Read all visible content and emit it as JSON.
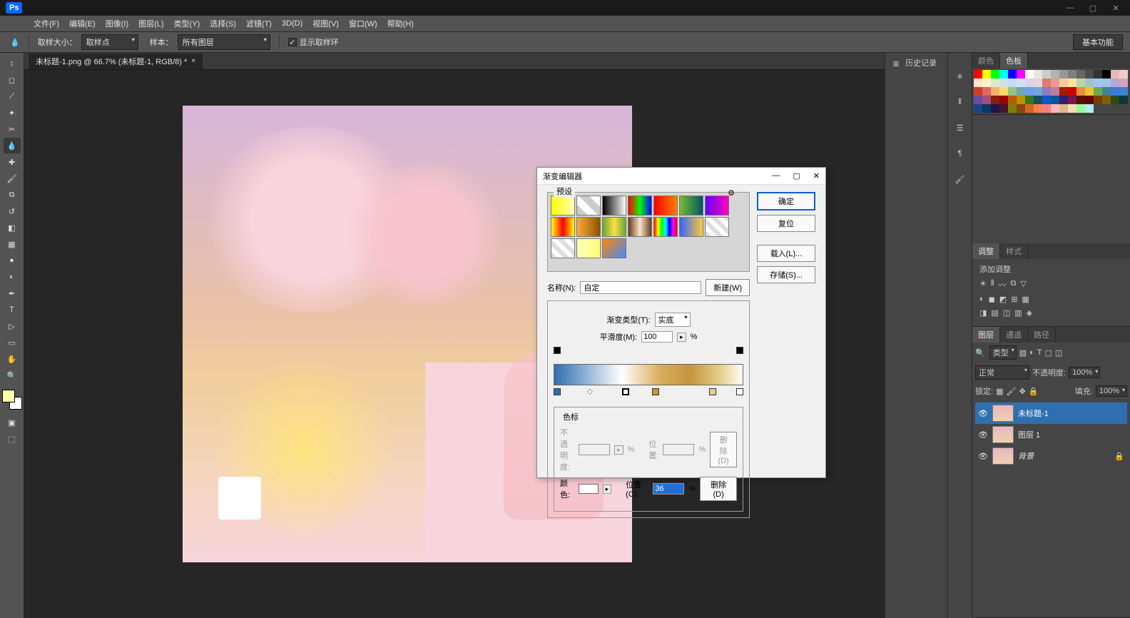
{
  "app": {
    "logo": "Ps"
  },
  "menu": [
    "文件(F)",
    "编辑(E)",
    "图像(I)",
    "图层(L)",
    "类型(Y)",
    "选择(S)",
    "滤镜(T)",
    "3D(D)",
    "视图(V)",
    "窗口(W)",
    "帮助(H)"
  ],
  "options": {
    "sample_size_label": "取样大小：",
    "sample_size_value": "取样点",
    "sample_label": "样本：",
    "sample_value": "所有图层",
    "show_ring": "显示取样环",
    "essentials": "基本功能"
  },
  "tab_title": "未标题-1.png @ 66.7% (未标题-1, RGB/8) *",
  "history_label": "历史记录",
  "gradient_dialog": {
    "title": "渐变编辑器",
    "presets_label": "预设",
    "ok": "确定",
    "cancel": "复位",
    "load": "载入(L)...",
    "save": "存储(S)...",
    "name_label": "名称(N):",
    "name_value": "自定",
    "new_btn": "新建(W)",
    "type_label": "渐变类型(T):",
    "type_value": "实底",
    "smoothness_label": "平滑度(M):",
    "smoothness_value": "100",
    "stops_label": "色标",
    "opacity_label": "不透明度:",
    "location_label": "位置:",
    "delete1": "删除(D)",
    "color_label": "颜色:",
    "location2_label": "位置(C):",
    "location2_value": "36",
    "delete2": "删除(D)",
    "percent": "%"
  },
  "right": {
    "color_tab": "颜色",
    "swatch_tab": "色板",
    "adjust_tab": "调整",
    "style_tab": "样式",
    "adjust_title": "添加调整",
    "layer_tab": "图层",
    "channel_tab": "通道",
    "path_tab": "路径",
    "kind_label": "类型",
    "blend_mode": "正常",
    "opacity_label": "不透明度:",
    "opacity_value": "100%",
    "lock_label": "锁定:",
    "fill_label": "填充:",
    "fill_value": "100%",
    "layers": [
      {
        "name": "未标题-1"
      },
      {
        "name": "图层 1"
      },
      {
        "name": "背景"
      }
    ]
  },
  "swatch_colors": [
    "#ff0000",
    "#ffff00",
    "#00ff00",
    "#00ffff",
    "#0000ff",
    "#ff00ff",
    "#ffffff",
    "#e5e5e5",
    "#cccccc",
    "#b3b3b3",
    "#999999",
    "#808080",
    "#666666",
    "#4d4d4d",
    "#333333",
    "#000000",
    "#e6b8af",
    "#f4cccc",
    "#fce5cd",
    "#fff2cc",
    "#d9ead3",
    "#d0e0e3",
    "#c9daf8",
    "#cfe2f3",
    "#d9d2e9",
    "#ead1dc",
    "#dd7e6b",
    "#ea9999",
    "#f9cb9c",
    "#ffe599",
    "#b6d7a8",
    "#a2c4c9",
    "#a4c2f4",
    "#9fc5e8",
    "#b4a7d6",
    "#d5a6bd",
    "#cc4125",
    "#e06666",
    "#f6b26b",
    "#ffd966",
    "#93c47d",
    "#76a5af",
    "#6d9eeb",
    "#6fa8dc",
    "#8e7cc3",
    "#c27ba0",
    "#a61c00",
    "#cc0000",
    "#e69138",
    "#f1c232",
    "#6aa84f",
    "#45818e",
    "#3c78d8",
    "#3d85c6",
    "#674ea7",
    "#a64d79",
    "#85200c",
    "#990000",
    "#b45f06",
    "#bf9000",
    "#38761d",
    "#134f5c",
    "#1155cc",
    "#0b5394",
    "#351c75",
    "#741b47",
    "#5b0f00",
    "#660000",
    "#783f04",
    "#7f6000",
    "#274e13",
    "#0c343d",
    "#1c4587",
    "#073763",
    "#20124d",
    "#4c1130",
    "#808000",
    "#8b4513",
    "#d2691e",
    "#ff7f50",
    "#f08080",
    "#ffb6c1",
    "#deb887",
    "#f5deb3",
    "#98fb98",
    "#afeeee"
  ],
  "preset_gradients": [
    "linear-gradient(90deg,#ff0,#ffb)",
    "linear-gradient(45deg,#ccc 25%,#fff 25%,#fff 50%,#ccc 50%,#ccc 75%,#fff 75%)",
    "linear-gradient(90deg,#000,#fff)",
    "linear-gradient(90deg,#f00,#0f0,#00f)",
    "linear-gradient(90deg,#f00,#ff8000)",
    "linear-gradient(90deg,#7b3,#056)",
    "linear-gradient(90deg,#60f,#f0b)",
    "linear-gradient(90deg,#ff0,#f00,#ff0)",
    "linear-gradient(90deg,#fa3,#850)",
    "linear-gradient(90deg,#6a3,#fd4,#6a3)",
    "linear-gradient(90deg,#6b3a1f,#f9e5c9,#6b3a1f)",
    "linear-gradient(90deg,#f00,#ff0,#0f0,#0ff,#00f,#f0f,#f00)",
    "linear-gradient(90deg,#36f,#fc3)",
    "repeating-linear-gradient(45deg,#ddd 0 6px,#fff 6px 12px)",
    "repeating-linear-gradient(45deg,#ddd 0 6px,#fff 6px 12px)",
    "linear-gradient(90deg,#ffb,#ff7)",
    "linear-gradient(135deg,#f80,#48f)"
  ]
}
